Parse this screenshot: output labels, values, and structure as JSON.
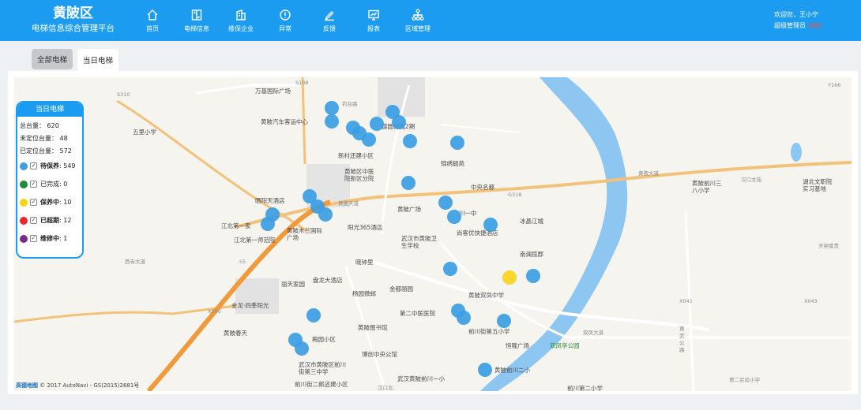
{
  "brand": {
    "title": "黄陂区",
    "subtitle": "电梯信息综合管理平台"
  },
  "nav": [
    {
      "label": "首页",
      "icon": "home-icon"
    },
    {
      "label": "电梯信息",
      "icon": "elevator-icon"
    },
    {
      "label": "维保企业",
      "icon": "building-icon"
    },
    {
      "label": "异常",
      "icon": "alert-icon"
    },
    {
      "label": "反馈",
      "icon": "pencil-icon"
    },
    {
      "label": "报表",
      "icon": "report-icon"
    },
    {
      "label": "区域管理",
      "icon": "hierarchy-icon"
    }
  ],
  "user": {
    "greeting": "欢迎您，王小宁",
    "role": "超级管理员",
    "logout": "退出"
  },
  "tabs": [
    {
      "label": "全部电梯"
    },
    {
      "label": "当日电梯"
    }
  ],
  "legend": {
    "title": "当日电梯",
    "total": "总台量： 620",
    "unlocated": "未定位台量： 48",
    "located": "已定位台量： 572",
    "items": [
      {
        "name": "待保养",
        "count": ": 549",
        "color": "#3b9de3"
      },
      {
        "name": "已完成",
        "count": ": 0",
        "color": "#1e8a3a"
      },
      {
        "name": "保养中",
        "count": ": 10",
        "color": "#f7d31a"
      },
      {
        "name": "已超期",
        "count": ": 12",
        "color": "#e8282d"
      },
      {
        "name": "维修中",
        "count": ": 1",
        "color": "#7a2a8f"
      }
    ]
  },
  "map": {
    "attribution_logo": "高德地图",
    "attribution_text": "© 2017 AutoNavi - GS(2015)2681号",
    "pois": [
      "万基国际广场",
      "钓台路",
      "五里小学",
      "黄陂汽车客运中心",
      "德圆诗城2期",
      "新村还建小区",
      "黄陂区中医院新区分院",
      "锦绣毓苑",
      "中央名都",
      "黄陂天道",
      "黄陂大道",
      "晒阳天酒店",
      "江北第一家",
      "黄陂木兰国际广场",
      "阳光365酒店",
      "江北第一师范院",
      "黄陂广场",
      "川一中",
      "尚客优快捷酒店",
      "冰晶江城",
      "武汉市黄陂卫生学校",
      "南澜揽郡",
      "晓钟里",
      "盘龙大酒店",
      "丽天家园",
      "金都丽园",
      "杨园微邮",
      "西寺大道",
      "金龙·四季阳光",
      "第二中医医院",
      "黄陂双凤中学",
      "前川街第五小学",
      "黄陂图书馆",
      "黄陂春天",
      "梅园小区",
      "博创中央公馆",
      "武汉市黄陂区前川街第三中学",
      "前川街二郎还建小区",
      "武汉黄陂前川一小",
      "黄陂前川二小",
      "前川第二小学",
      "双凤亭公园",
      "双凤大道",
      "恒隆广场",
      "汉口北",
      "汉口文苑",
      "湖北文职院实习基地",
      "黄陂前川三八小学",
      "天钟富贵",
      "黄武公路",
      "第二实验小学"
    ],
    "road_labels": [
      "S310",
      "S108",
      "G318",
      "S5",
      "Y166",
      "X041",
      "X043",
      "X050"
    ]
  },
  "colors": {
    "header": "#1c9cf0",
    "river": "#8ec6f2",
    "marker_default": "#3b9de3",
    "marker_in_progress": "#f7d31a",
    "logout": "#ff4a3d"
  }
}
